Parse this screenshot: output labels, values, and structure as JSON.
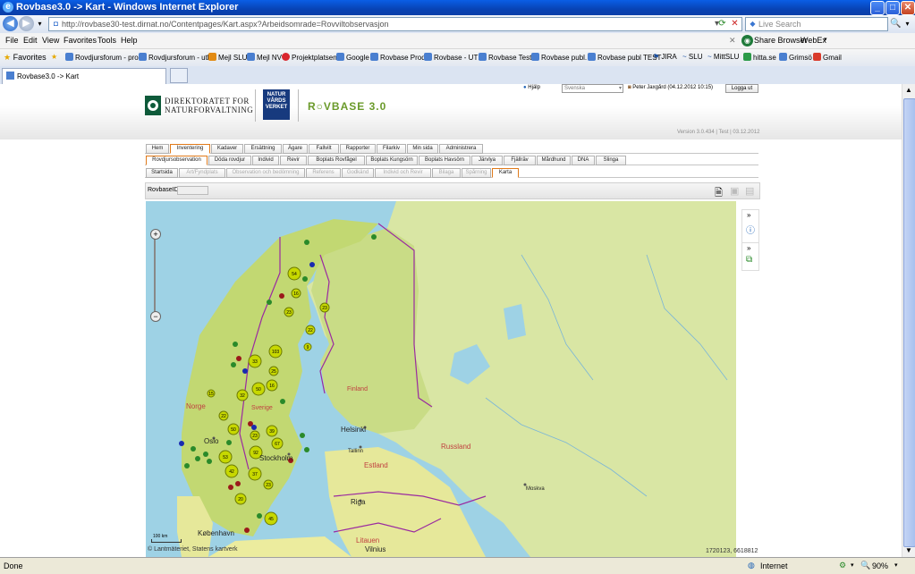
{
  "window": {
    "title": "Rovbase3.0 -> Kart - Windows Internet Explorer",
    "minimize": "_",
    "maximize": "□",
    "close": "✕"
  },
  "address": {
    "url": "http://rovbase30-test.dirnat.no/Contentpages/Kart.aspx?Arbeidsomrade=Rovviltobservasjon",
    "search_placeholder": "Live Search"
  },
  "menu": {
    "items": [
      "File",
      "Edit",
      "View",
      "Favorites",
      "Tools",
      "Help"
    ],
    "share_browser": "Share Browser",
    "webex": "WebEx"
  },
  "favorites": {
    "label": "Favorites",
    "items": [
      "Rovdjursforum - prod",
      "Rovdjursforum - utb",
      "Mejl SLU",
      "Mejl NV",
      "Projektplatsen",
      "Google",
      "Rovbase Prod",
      "Rovbase - UTB",
      "Rovbase Test",
      "Rovbase publ.",
      "Rovbase publ TEST",
      "JIRA",
      "SLU",
      "MittSLU",
      "hitta.se",
      "Grimsö",
      "Gmail"
    ]
  },
  "tab": {
    "label": "Rovbase3.0 -> Kart"
  },
  "header": {
    "org": "DIREKTORATET FOR\nNATURFORVALTNING",
    "org_line1": "DIREKTORATET FOR",
    "org_line2": "NATURFORVALTNING",
    "nv_logo_line1": "NATUR",
    "nv_logo_line2": "VÅRDS",
    "nv_logo_line3": "VERKET",
    "app_name": "R○VBASE 3.0",
    "help": "Hjälp",
    "language": "Svenska",
    "user": "Peter Jaxgård (04.12.2012 10:15)",
    "logout": "Logga ut",
    "version": "Version 3.0.434 | Test | 03.12.2012"
  },
  "nav": {
    "main_tabs": [
      "Hem",
      "Inventering",
      "Kadaver",
      "Ersättning",
      "Ägare",
      "Fallvilt",
      "Rapporter",
      "Filarkiv",
      "Min sida",
      "Administrera"
    ],
    "sub_tabs": [
      "Rovdjursobservation",
      "Döda rovdjur",
      "Individ",
      "Revir",
      "Boplats Rovfågel",
      "Boplats Kungsörn",
      "Boplats Havsörn",
      "Järvlya",
      "Fjällräv",
      "Mårdhund",
      "DNA",
      "Slinga"
    ],
    "third_tabs": [
      "Startsida",
      "Art/Fyndplats",
      "Observation och bedömning",
      "Referens",
      "Godkänd",
      "Individ och Revir",
      "Bilaga",
      "Spårning",
      "Karta"
    ]
  },
  "rovbase_id_label": "RovbaseID",
  "map": {
    "labels": {
      "norge": "Norge",
      "oslo": "Oslo",
      "stockholm": "Stockholm",
      "helsinki": "Helsinki",
      "tallinn": "Tallinn",
      "estland": "Estland",
      "riga": "Riga",
      "moskva": "Moskva",
      "russland": "Russland",
      "kobenhavn": "København",
      "litauen": "Litauen",
      "vilnius": "Vilnius",
      "finland": "Finland",
      "sverige": "Sverige"
    },
    "clusters": [
      "54",
      "16",
      "23",
      "23",
      "22",
      "103",
      "9",
      "33",
      "25",
      "32",
      "15",
      "50",
      "16",
      "22",
      "50",
      "39",
      "23",
      "67",
      "92",
      "53",
      "42",
      "37",
      "23",
      "20",
      "45"
    ],
    "scale": "100 km",
    "copyright": "© Lantmäteriet, Statens kartverk",
    "coords": "1720123, 6618812"
  },
  "statusbar": {
    "text": "Done",
    "zone": "Internet",
    "zoom": "90%"
  }
}
